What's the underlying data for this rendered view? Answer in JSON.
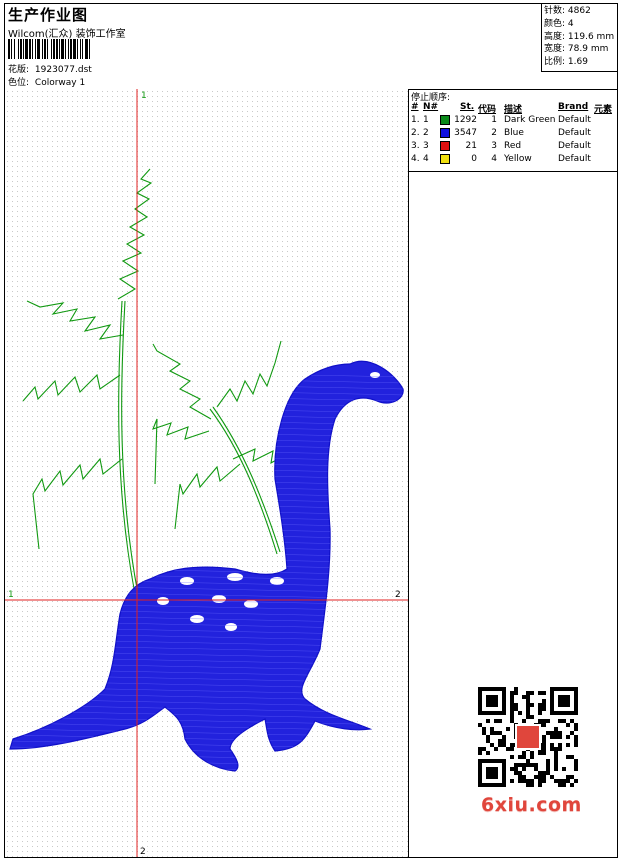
{
  "header": {
    "title": "生产作业图",
    "company": "Wilcom(汇众) 装饰工作室",
    "design_label": "花版:",
    "design_value": "1923077.dst",
    "colorway_label": "色位:",
    "colorway_value": "Colorway 1"
  },
  "stats": [
    {
      "label": "针数:",
      "value": "4862"
    },
    {
      "label": "颜色:",
      "value": "4"
    },
    {
      "label": "高度:",
      "value": "119.6 mm"
    },
    {
      "label": "宽度:",
      "value": "78.9 mm"
    },
    {
      "label": "比例:",
      "value": "1.69"
    }
  ],
  "stop_sequence": {
    "title": "停止顺序:",
    "headers": [
      "#",
      "N#",
      "St.",
      "代码",
      "描述",
      "Brand",
      "元素"
    ],
    "rows": [
      {
        "num": "1.",
        "n": "1",
        "color": "#0a8a1a",
        "stitches": "1292",
        "code": "1",
        "desc": "Dark Green",
        "brand": "Default"
      },
      {
        "num": "2.",
        "n": "2",
        "color": "#1010e0",
        "stitches": "3547",
        "code": "2",
        "desc": "Blue",
        "brand": "Default"
      },
      {
        "num": "3.",
        "n": "3",
        "color": "#e01010",
        "stitches": "21",
        "code": "3",
        "desc": "Red",
        "brand": "Default"
      },
      {
        "num": "4.",
        "n": "4",
        "color": "#f0e010",
        "stitches": "0",
        "code": "4",
        "desc": "Yellow",
        "brand": "Default"
      }
    ]
  },
  "canvas": {
    "axis_labels": {
      "top": "1",
      "left": "1",
      "right": "2",
      "bottom": "2"
    },
    "colors": {
      "axis": "#e02020",
      "green": "#119911",
      "blue": "#1a1ae6"
    }
  },
  "watermark": {
    "text": "6xiu.com",
    "color": "#e0463c"
  }
}
